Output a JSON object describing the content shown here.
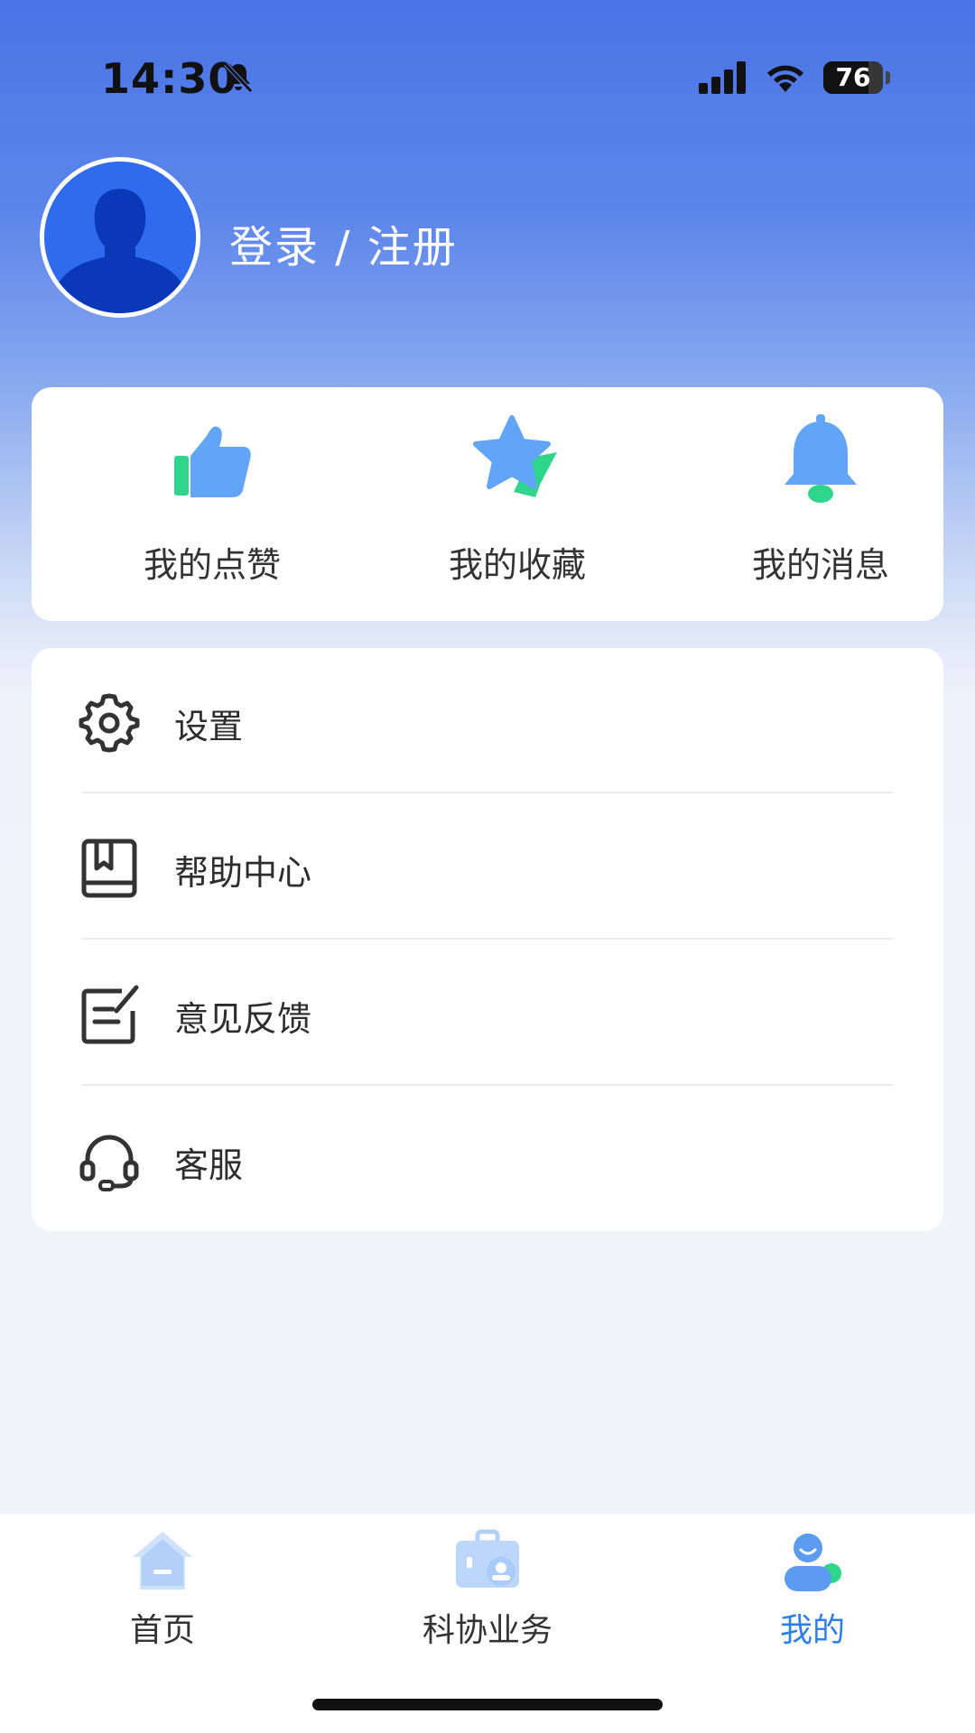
{
  "status_bar": {
    "time": "14:30",
    "battery": "76",
    "battery_level": 0.76,
    "icons": [
      "bell-off-icon",
      "signal-icon",
      "wifi-icon",
      "battery-icon"
    ]
  },
  "profile": {
    "login_label": "登录 / 注册",
    "avatar_icon": "user-avatar-icon"
  },
  "quick_actions": [
    {
      "label": "我的点赞",
      "icon": "thumbs-up-icon"
    },
    {
      "label": "我的收藏",
      "icon": "star-icon"
    },
    {
      "label": "我的消息",
      "icon": "bell-icon"
    }
  ],
  "menu": [
    {
      "label": "设置",
      "icon": "gear-icon"
    },
    {
      "label": "帮助中心",
      "icon": "book-icon"
    },
    {
      "label": "意见反馈",
      "icon": "feedback-edit-icon"
    },
    {
      "label": "客服",
      "icon": "headset-icon"
    }
  ],
  "tab_bar": {
    "tabs": [
      {
        "label": "首页",
        "icon": "home-icon",
        "active": false
      },
      {
        "label": "科协业务",
        "icon": "briefcase-icon",
        "active": false
      },
      {
        "label": "我的",
        "icon": "profile-icon",
        "active": true
      }
    ]
  },
  "colors": {
    "header_blue": "#4a73e6",
    "accent_blue": "#2f7fe3",
    "icon_blue": "#62a4f6",
    "icon_green": "#2fd58b",
    "page_bg": "#f1f3fb"
  }
}
